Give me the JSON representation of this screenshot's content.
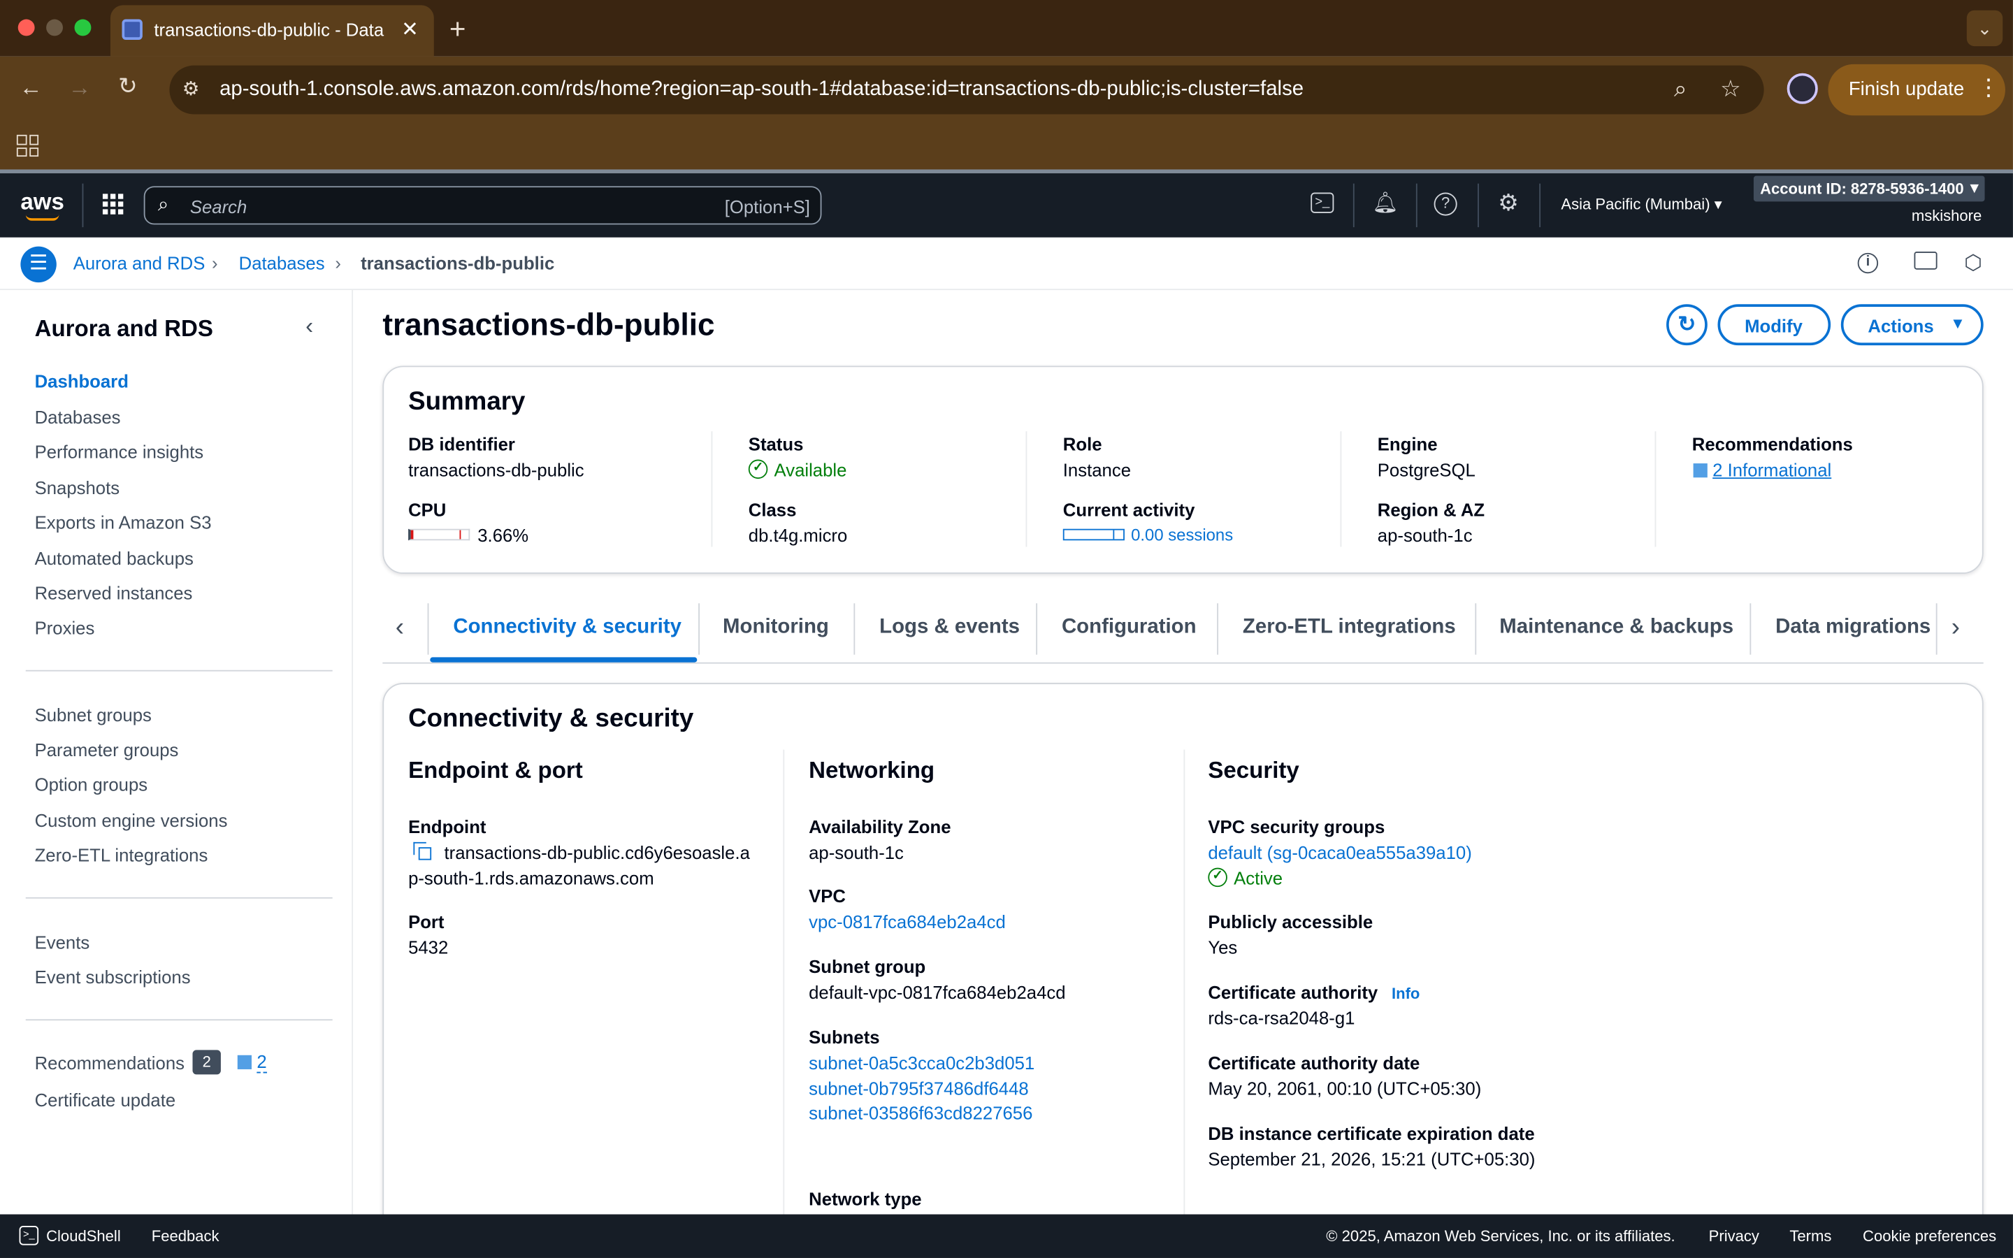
{
  "browser": {
    "tab_title": "transactions-db-public - Data",
    "url": "ap-south-1.console.aws.amazon.com/rds/home?region=ap-south-1#database:id=transactions-db-public;is-cluster=false",
    "finish_update": "Finish update"
  },
  "aws_header": {
    "logo": "aws",
    "search_placeholder": "Search",
    "search_shortcut": "[Option+S]",
    "region": "Asia Pacific (Mumbai)",
    "account_id": "Account ID: 8278-5936-1400",
    "user": "mskishore"
  },
  "breadcrumb": [
    "Aurora and RDS",
    "Databases",
    "transactions-db-public"
  ],
  "sidebar": {
    "title": "Aurora and RDS",
    "group1": [
      "Dashboard",
      "Databases",
      "Performance insights",
      "Snapshots",
      "Exports in Amazon S3",
      "Automated backups",
      "Reserved instances",
      "Proxies"
    ],
    "group2": [
      "Subnet groups",
      "Parameter groups",
      "Option groups",
      "Custom engine versions",
      "Zero-ETL integrations"
    ],
    "group3": [
      "Events",
      "Event subscriptions"
    ],
    "recommendations_label": "Recommendations",
    "recommendations_count": "2",
    "recommendations_info_count": "2",
    "certificate_update": "Certificate update"
  },
  "page": {
    "title": "transactions-db-public",
    "modify": "Modify",
    "actions": "Actions"
  },
  "summary": {
    "title": "Summary",
    "db_identifier_label": "DB identifier",
    "db_identifier": "transactions-db-public",
    "cpu_label": "CPU",
    "cpu_value": "3.66%",
    "cpu_fraction": 0.0366,
    "status_label": "Status",
    "status": "Available",
    "class_label": "Class",
    "class": "db.t4g.micro",
    "role_label": "Role",
    "role": "Instance",
    "activity_label": "Current activity",
    "activity": "0.00 sessions",
    "engine_label": "Engine",
    "engine": "PostgreSQL",
    "region_label": "Region & AZ",
    "region": "ap-south-1c",
    "recommendations_label": "Recommendations",
    "recommendations": "2 Informational"
  },
  "tabs": [
    "Connectivity & security",
    "Monitoring",
    "Logs & events",
    "Configuration",
    "Zero-ETL integrations",
    "Maintenance & backups",
    "Data migrations"
  ],
  "connectivity": {
    "title": "Connectivity & security",
    "endpoint_section": "Endpoint & port",
    "endpoint_label": "Endpoint",
    "endpoint_line1": "transactions-db-public.cd6y6esoasle.a",
    "endpoint_line2": "p-south-1.rds.amazonaws.com",
    "port_label": "Port",
    "port": "5432",
    "networking_section": "Networking",
    "az_label": "Availability Zone",
    "az": "ap-south-1c",
    "vpc_label": "VPC",
    "vpc": "vpc-0817fca684eb2a4cd",
    "subnet_group_label": "Subnet group",
    "subnet_group": "default-vpc-0817fca684eb2a4cd",
    "subnets_label": "Subnets",
    "subnets": [
      "subnet-0a5c3cca0c2b3d051",
      "subnet-0b795f37486df6448",
      "subnet-03586f63cd8227656"
    ],
    "network_type_label": "Network type",
    "security_section": "Security",
    "sg_label": "VPC security groups",
    "sg": "default (sg-0caca0ea555a39a10)",
    "sg_status": "Active",
    "public_label": "Publicly accessible",
    "public": "Yes",
    "ca_label": "Certificate authority",
    "ca_info": "Info",
    "ca": "rds-ca-rsa2048-g1",
    "ca_date_label": "Certificate authority date",
    "ca_date": "May 20, 2061, 00:10 (UTC+05:30)",
    "cert_exp_label": "DB instance certificate expiration date",
    "cert_exp": "September 21, 2026, 15:21 (UTC+05:30)"
  },
  "footer": {
    "cloudshell": "CloudShell",
    "feedback": "Feedback",
    "copyright": "© 2025, Amazon Web Services, Inc. or its affiliates.",
    "privacy": "Privacy",
    "terms": "Terms",
    "cookies": "Cookie preferences"
  },
  "colors": {
    "link": "#0972d3",
    "success": "#037f0c",
    "header": "#161d26"
  }
}
